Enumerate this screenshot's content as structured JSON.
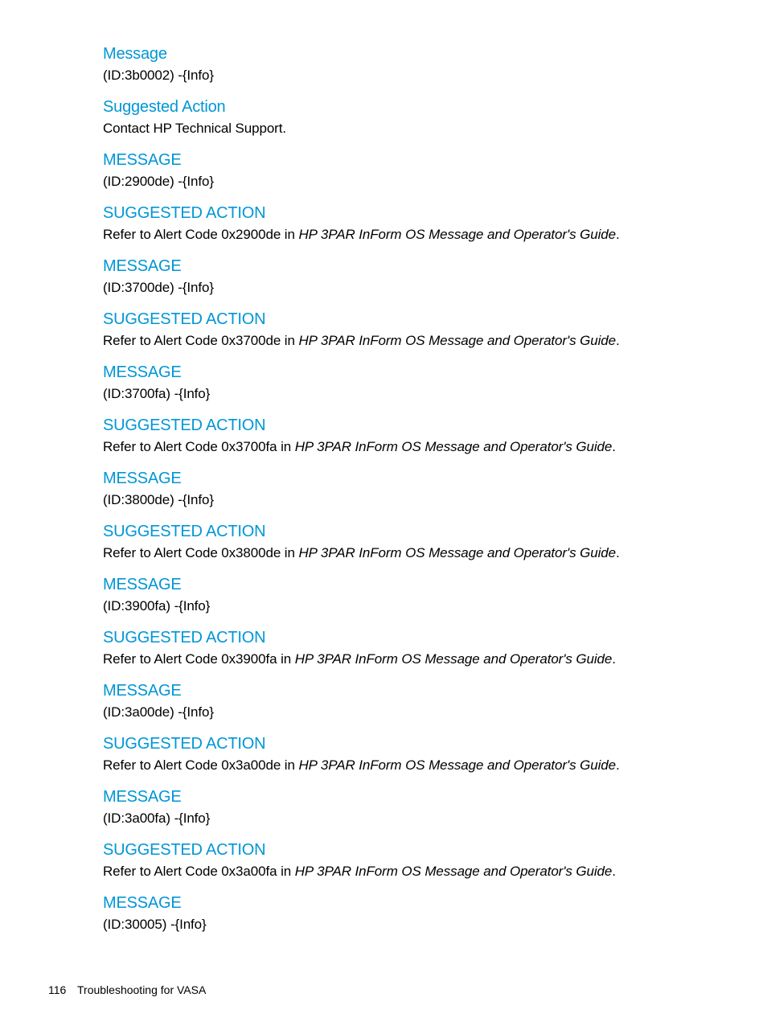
{
  "first": {
    "message_heading": "Message",
    "message_body": "(ID:3b0002) -{Info}",
    "action_heading": "Suggested Action",
    "action_body": "Contact HP Technical Support."
  },
  "entries": [
    {
      "message_heading": "MESSAGE",
      "message_body": "(ID:2900de) -{Info}",
      "action_heading": "SUGGESTED ACTION",
      "action_prefix": "Refer to Alert Code 0x2900de in ",
      "guide_title": "HP 3PAR InForm OS Message and Operator's Guide",
      "action_suffix": "."
    },
    {
      "message_heading": "MESSAGE",
      "message_body": "(ID:3700de) -{Info}",
      "action_heading": "SUGGESTED ACTION",
      "action_prefix": "Refer to Alert Code 0x3700de in ",
      "guide_title": "HP 3PAR InForm OS Message and Operator's Guide",
      "action_suffix": "."
    },
    {
      "message_heading": "MESSAGE",
      "message_body": "(ID:3700fa) -{Info}",
      "action_heading": "SUGGESTED ACTION",
      "action_prefix": "Refer to Alert Code 0x3700fa in ",
      "guide_title": "HP 3PAR InForm OS Message and Operator's Guide",
      "action_suffix": "."
    },
    {
      "message_heading": "MESSAGE",
      "message_body": "(ID:3800de) -{Info}",
      "action_heading": "SUGGESTED ACTION",
      "action_prefix": "Refer to Alert Code 0x3800de in ",
      "guide_title": "HP 3PAR InForm OS Message and Operator's Guide",
      "action_suffix": "."
    },
    {
      "message_heading": "MESSAGE",
      "message_body": "(ID:3900fa) -{Info}",
      "action_heading": "SUGGESTED ACTION",
      "action_prefix": "Refer to Alert Code 0x3900fa in ",
      "guide_title": "HP 3PAR InForm OS Message and Operator's Guide",
      "action_suffix": "."
    },
    {
      "message_heading": "MESSAGE",
      "message_body": "(ID:3a00de) -{Info}",
      "action_heading": "SUGGESTED ACTION",
      "action_prefix": "Refer to Alert Code 0x3a00de in ",
      "guide_title": "HP 3PAR InForm OS Message and Operator's Guide",
      "action_suffix": "."
    },
    {
      "message_heading": "MESSAGE",
      "message_body": "(ID:3a00fa) -{Info}",
      "action_heading": "SUGGESTED ACTION",
      "action_prefix": "Refer to Alert Code 0x3a00fa in ",
      "guide_title": "HP 3PAR InForm OS Message and Operator's Guide",
      "action_suffix": "."
    }
  ],
  "last": {
    "message_heading": "MESSAGE",
    "message_body": "(ID:30005) -{Info}"
  },
  "footer": {
    "page_number": "116",
    "section_title": "Troubleshooting for VASA"
  },
  "colors": {
    "heading": "#0096d6",
    "body": "#000000"
  }
}
